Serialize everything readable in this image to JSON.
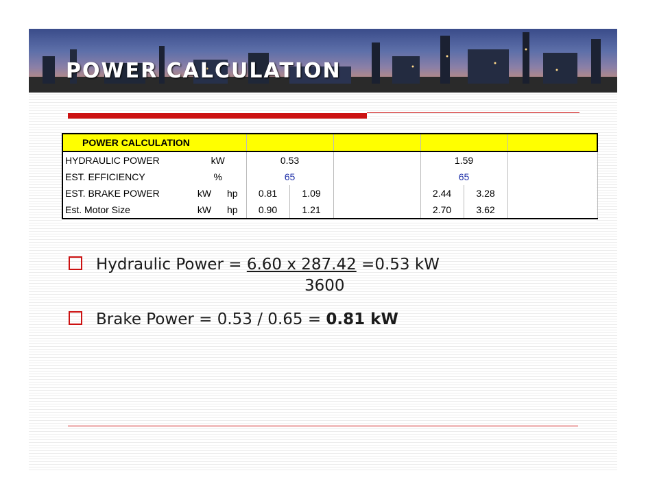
{
  "header": {
    "title": "POWER CALCULATION"
  },
  "table": {
    "header_label": "POWER CALCULATION",
    "rows": [
      {
        "label": "HYDRAULIC POWER",
        "unit1": "kW",
        "unit2": "",
        "a1": "0.53",
        "a2": "",
        "b1": "1.59",
        "b2": ""
      },
      {
        "label": "EST. EFFICIENCY",
        "unit1": "%",
        "unit2": "",
        "a1": "65",
        "a2": "",
        "b1": "65",
        "b2": ""
      },
      {
        "label": "EST. BRAKE POWER",
        "unit1": "kW",
        "unit2": "hp",
        "a1": "0.81",
        "a2": "1.09",
        "b1": "2.44",
        "b2": "3.28"
      },
      {
        "label": "Est. Motor Size",
        "unit1": "kW",
        "unit2": "hp",
        "a1": "0.90",
        "a2": "1.21",
        "b1": "2.70",
        "b2": "3.62"
      }
    ]
  },
  "bullets": {
    "line1_prefix": "Hydraulic Power = ",
    "line1_numerator": "6.60 x 287.42",
    "line1_suffix": " =0.53 kW",
    "line1_denominator": "3600",
    "line2_prefix": "Brake Power = 0.53 / 0.65 = ",
    "line2_bold": "0.81 kW"
  },
  "colors": {
    "accent_red": "#cc1111",
    "table_header": "#ffff00",
    "value_blue": "#2233aa"
  }
}
